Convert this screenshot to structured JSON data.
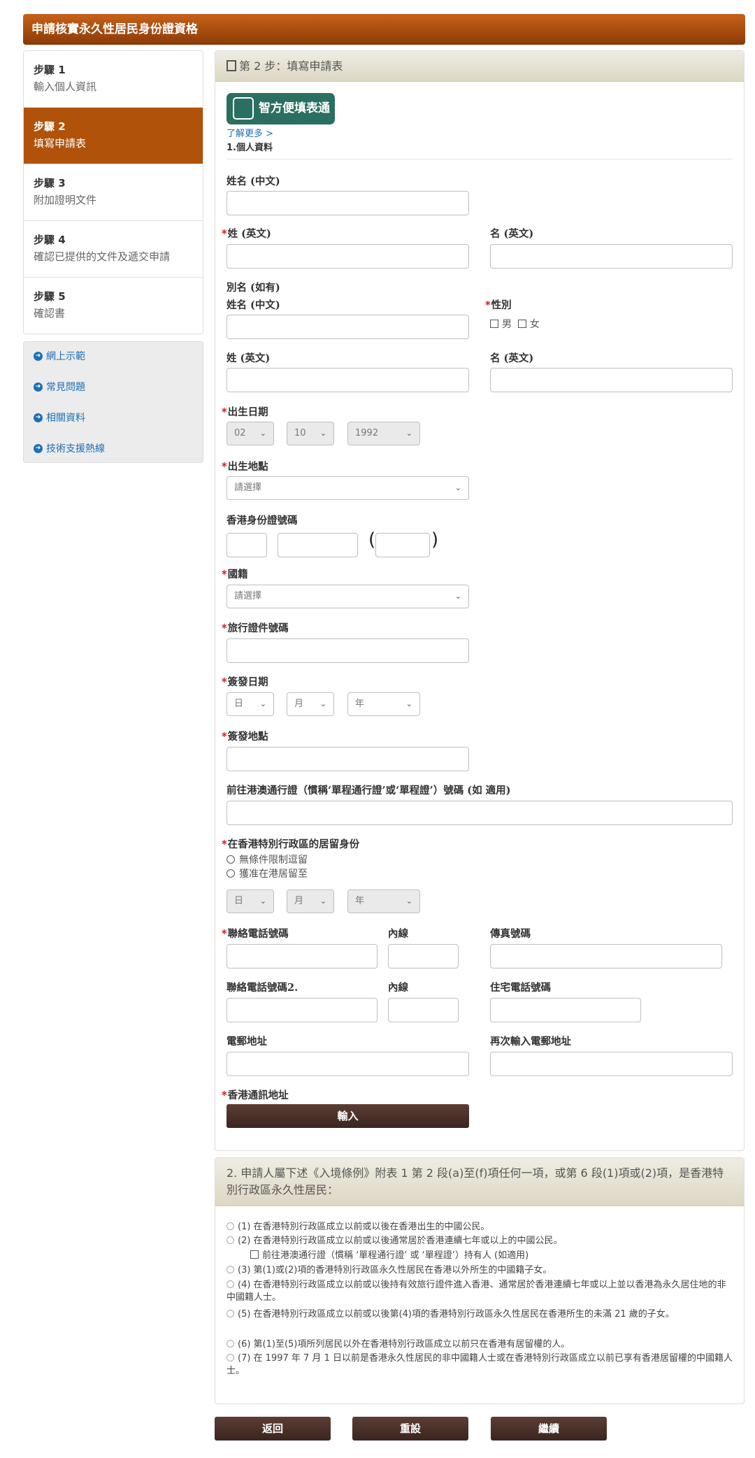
{
  "header": {
    "title": "申請核實永久性居民身份證資格"
  },
  "steps": [
    {
      "num": "步驟 1",
      "label": "輸入個人資訊"
    },
    {
      "num": "步驟 2",
      "label": "填寫申請表"
    },
    {
      "num": "步驟 3",
      "label": "附加證明文件"
    },
    {
      "num": "步驟 4",
      "label": "確認已提供的文件及遞交申請"
    },
    {
      "num": "步驟 5",
      "label": "確認書"
    }
  ],
  "links": [
    "網上示範",
    "常見問題",
    "相關資料",
    "技術支援熱線"
  ],
  "form": {
    "panel_title": "第 2 步：填寫申請表",
    "smart_label": "智方便填表通",
    "learn_more": "了解更多 >",
    "section1": "1.個人資料",
    "name_zh": "姓名 (中文)",
    "surname_en": "姓 (英文)",
    "given_en": "名 (英文)",
    "alias": "別名 (如有)",
    "alias_name_zh": "姓名 (中文)",
    "gender": "性別",
    "male": "男",
    "female": "女",
    "alias_surname_en": "姓 (英文)",
    "alias_given_en": "名 (英文)",
    "dob": "出生日期",
    "dob_day": "02",
    "dob_month": "10",
    "dob_year": "1992",
    "pob": "出生地點",
    "please_select": "請選擇",
    "hkid": "香港身份證號碼",
    "nationality": "國籍",
    "travel_doc": "旅行證件號碼",
    "issue_date": "簽發日期",
    "day": "日",
    "month": "月",
    "year": "年",
    "issue_place": "簽發地點",
    "one_way_permit": "前往港澳通行證（慣稱‘單程通行證’或‘單程證’）號碼 (如 適用)",
    "residence_status": "在香港特別行政區的居留身份",
    "unconditional": "無條件限制逗留",
    "permitted_until": "獲准在港居留至",
    "phone": "聯絡電話號碼",
    "ext": "內線",
    "fax": "傳真號碼",
    "phone2": "聯絡電話號碼2.",
    "ext2": "內線",
    "home_phone": "住宅電話號碼",
    "email": "電郵地址",
    "email_confirm": "再次輸入電郵地址",
    "hk_address": "香港通訊地址",
    "enter_button": "輸入"
  },
  "section2": {
    "title": "2. 申請人屬下述《入境條例》附表 1 第 2 段(a)至(f)項任何一項，或第 6 段(1)項或(2)項，是香港特別行政區永久性居民：",
    "options": [
      "(1) 在香港特別行政區成立以前或以後在香港出生的中國公民。",
      "(2) 在香港特別行政區成立以前或以後通常居於香港連續七年或以上的中國公民。",
      "(3) 第(1)或(2)項的香港特別行政區永久性居民在香港以外所生的中國籍子女。",
      "(4) 在香港特別行政區成立以前或以後持有效旅行證件進入香港、通常居於香港連續七年或以上並以香港為永久居住地的非中國籍人士。",
      "(5) 在香港特別行政區成立以前或以後第(4)項的香港特別行政區永久性居民在香港所生的未滿 21 歲的子女。",
      "(6) 第(1)至(5)項所列居民以外在香港特別行政區成立以前只在香港有居留權的人。",
      "(7) 在 1997 年 7 月 1 日以前是香港永久性居民的非中國籍人士或在香港特別行政區成立以前已享有香港居留權的中國籍人士。"
    ],
    "sub_option": "前往港澳通行證（慣稱 ‘單程通行證’ 或 ‘單程證’）持有人 (如適用)"
  },
  "footer": {
    "back": "返回",
    "reset": "重設",
    "continue": "繼續"
  }
}
